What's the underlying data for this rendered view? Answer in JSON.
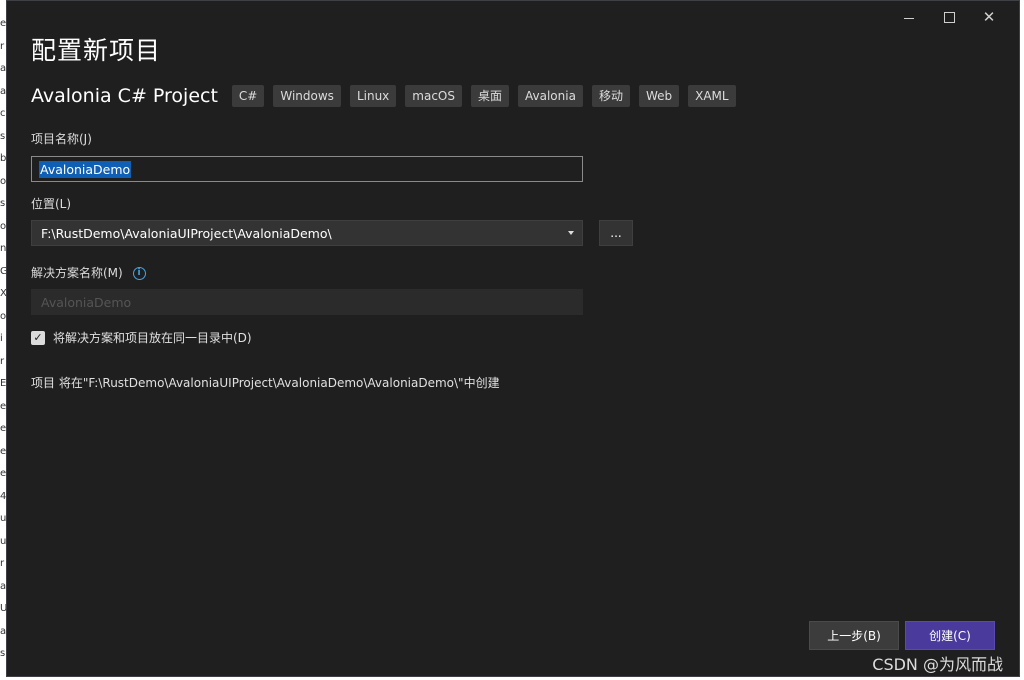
{
  "background_strip": [
    "e",
    "r",
    "a",
    "a",
    "c",
    "s",
    "b",
    "o",
    "s",
    "o",
    "n",
    "G",
    "X",
    "or",
    "i",
    "r",
    "E",
    "e",
    "e",
    "et",
    "e",
    "4",
    "ub",
    "ub",
    "r",
    "a",
    "U",
    "a",
    "s"
  ],
  "window": {
    "title": "配置新项目",
    "controls": [
      "minimize-icon",
      "maximize-icon",
      "close-icon"
    ]
  },
  "template": {
    "name": "Avalonia C# Project",
    "tags": [
      "C#",
      "Windows",
      "Linux",
      "macOS",
      "桌面",
      "Avalonia",
      "移动",
      "Web",
      "XAML"
    ]
  },
  "form": {
    "project_name_label": "项目名称(J)",
    "project_name_value": "AvaloniaDemo",
    "location_label": "位置(L)",
    "location_value": "F:\\RustDemo\\AvaloniaUIProject\\AvaloniaDemo\\",
    "browse_label": "...",
    "solution_name_label": "解决方案名称(M)",
    "solution_name_value": "AvaloniaDemo",
    "same_dir_label": "将解决方案和项目放在同一目录中(D)",
    "same_dir_checked": true,
    "note": "项目 将在\"F:\\RustDemo\\AvaloniaUIProject\\AvaloniaDemo\\AvaloniaDemo\\\"中创建"
  },
  "footer": {
    "back_label": "上一步(B)",
    "create_label": "创建(C)"
  },
  "watermark": "CSDN @为风而战",
  "colors": {
    "dialog_bg": "#1f1f1f",
    "accent": "#4a3a9c",
    "selection": "#0f5fb5",
    "info": "#4aa3df"
  }
}
